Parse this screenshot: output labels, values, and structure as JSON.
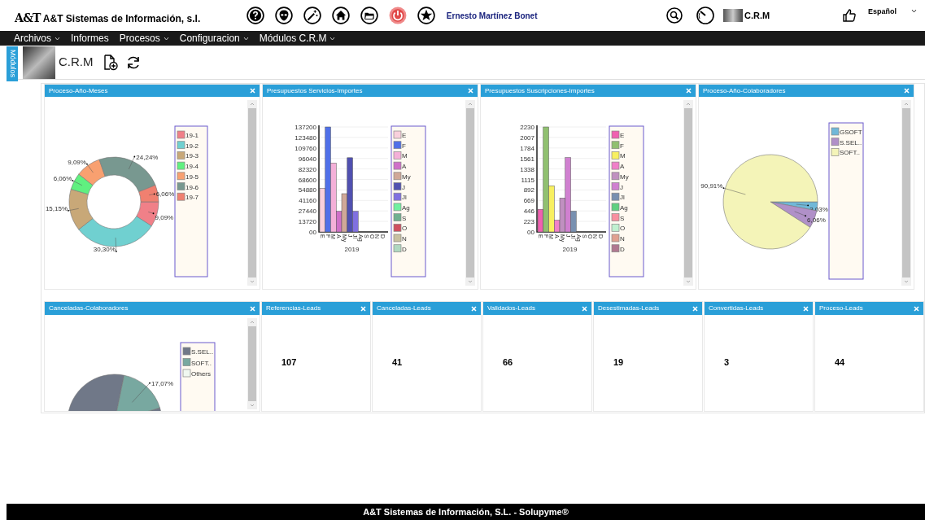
{
  "header": {
    "logo": "A&T",
    "company": "A&T Sistemas de Información, s.l.",
    "user": "Ernesto Martínez Bonet",
    "module": "C.R.M",
    "language": "Español"
  },
  "menu": [
    {
      "label": "Archivos",
      "dropdown": true
    },
    {
      "label": "Informes",
      "dropdown": false
    },
    {
      "label": "Procesos",
      "dropdown": true
    },
    {
      "label": "Configuracion",
      "dropdown": true
    },
    {
      "label": "Módulos C.R.M",
      "dropdown": true
    }
  ],
  "side_tab": "Módulos",
  "toolbar": {
    "title": "C.R.M"
  },
  "charts": [
    {
      "title": "Proceso-Año-Meses",
      "chart_data": {
        "type": "donut",
        "categories": [
          "19-1",
          "19-2",
          "19-3",
          "19-4",
          "19-5",
          "19-6",
          "19-7"
        ],
        "values": [
          9.09,
          30.3,
          15.15,
          6.06,
          9.09,
          24.24,
          6.06
        ],
        "colors": [
          "#f08088",
          "#70d0d0",
          "#c8a878",
          "#60f080",
          "#f8a070",
          "#789890",
          "#f08070"
        ],
        "value_labels": [
          "9,09%",
          "30,30%",
          "15,15%",
          "6,06%",
          "9,09%",
          "24,24%",
          "6,06%"
        ],
        "data_labels": true,
        "legend": "right"
      }
    },
    {
      "title": "Presupuestos Servicios-Importes",
      "chart_data": {
        "type": "bar",
        "xlabel": "2019",
        "categories": [
          "E",
          "F",
          "M",
          "A",
          "My",
          "J",
          "Jl",
          "Ag",
          "S",
          "O",
          "N",
          "D"
        ],
        "values": [
          57000,
          137200,
          90000,
          27000,
          50000,
          97000,
          27000,
          0,
          0,
          0,
          0,
          0
        ],
        "colors": [
          "#f8d0dc",
          "#5070e8",
          "#f4b0d8",
          "#d070c8",
          "#d0a898",
          "#5050b0",
          "#8070e0",
          "#70f0a0",
          "#70b090",
          "#d05060",
          "#c8c0a0",
          "#b0d8c0"
        ],
        "ylim": [
          0,
          137200
        ],
        "grid": true,
        "yticks": [
          {
            "value": 0,
            "label": "00"
          },
          13720,
          27440,
          41160,
          54880,
          68600,
          82320,
          96040,
          109760,
          123480,
          137200
        ]
      }
    },
    {
      "title": "Presupuestos Suscripciones-Importes",
      "chart_data": {
        "type": "bar",
        "xlabel": "2019",
        "categories": [
          "E",
          "F",
          "M",
          "A",
          "My",
          "J",
          "Jl",
          "Ag",
          "S",
          "O",
          "N",
          "D"
        ],
        "values": [
          480,
          2230,
          980,
          250,
          720,
          1580,
          440,
          0,
          0,
          0,
          0,
          0
        ],
        "colors": [
          "#f060b0",
          "#90c070",
          "#f8f060",
          "#f080c8",
          "#c090c0",
          "#d080d0",
          "#7890b0",
          "#60d080",
          "#f890a0",
          "#c0f0d0",
          "#e0a090",
          "#b07890"
        ],
        "ylim": [
          0,
          2230
        ],
        "grid": true,
        "yticks": [
          {
            "value": 0,
            "label": "00"
          },
          223,
          446,
          669,
          892,
          1115,
          1338,
          1561,
          1784,
          2007,
          2230
        ]
      }
    },
    {
      "title": "Proceso-Año-Colaboradores",
      "chart_data": {
        "type": "pie",
        "categories": [
          "GSOFT",
          "S.SEL..",
          "SOFT.."
        ],
        "values": [
          3.03,
          6.06,
          90.91
        ],
        "colors": [
          "#70b8d8",
          "#b090c8",
          "#f4f4b8"
        ],
        "value_labels": [
          "3,03%",
          "6,06%",
          "90,91%"
        ],
        "data_labels": true,
        "legend": "right"
      }
    },
    {
      "title": "Canceladas-Colaboradores",
      "chart_data": {
        "type": "pie",
        "categories": [
          "S.SEL..",
          "SOFT..",
          "Others"
        ],
        "values": [
          82.93,
          17.07,
          0
        ],
        "colors": [
          "#707888",
          "#78a8a0",
          "#f0f8f0"
        ],
        "value_labels": [
          null,
          "17,07%",
          null
        ],
        "data_labels": true,
        "legend": "right"
      }
    }
  ],
  "counters": [
    {
      "title": "Referencias-Leads",
      "value": "107"
    },
    {
      "title": "Canceladas-Leads",
      "value": "41"
    },
    {
      "title": "Validados-Leads",
      "value": "66"
    },
    {
      "title": "Desestimadas-Leads",
      "value": "19"
    },
    {
      "title": "Convertidas-Leads",
      "value": "3"
    },
    {
      "title": "Proceso-Leads",
      "value": "44"
    }
  ],
  "footer": "A&T Sistemas de Información, S.L. - Solupyme®"
}
